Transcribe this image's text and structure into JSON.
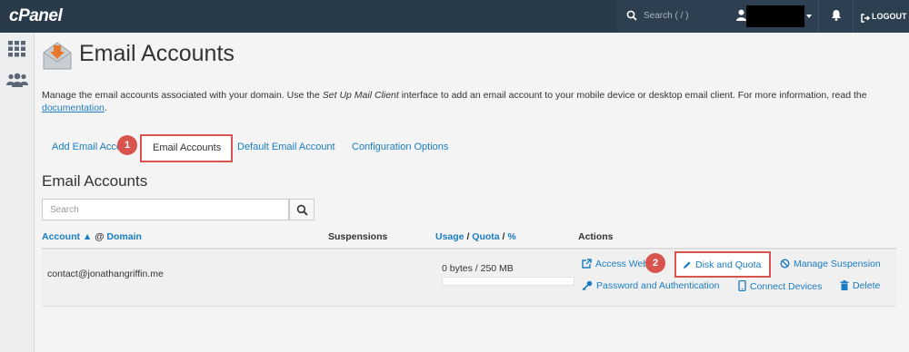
{
  "topbar": {
    "logo": "cPanel",
    "search_placeholder": "Search ( / )",
    "logout_label": "LOGOUT"
  },
  "page": {
    "title": "Email Accounts",
    "description_part1": "Manage the email accounts associated with your domain. Use the ",
    "description_em": "Set Up Mail Client",
    "description_part2": " interface to add an email account to your mobile device or desktop email client. For more information, read the ",
    "description_link": "documentation",
    "description_end": "."
  },
  "tabs": [
    {
      "label": "Add Email Acco"
    },
    {
      "label": "Email Accounts",
      "active": true
    },
    {
      "label": "Default Email Account"
    },
    {
      "label": "Configuration Options"
    }
  ],
  "badges": {
    "one": "1",
    "two": "2"
  },
  "section": {
    "title": "Email Accounts",
    "search_placeholder": "Search"
  },
  "table": {
    "headers": {
      "account": "Account",
      "sort_arrow": "▲",
      "at": "@",
      "domain": "Domain",
      "suspensions": "Suspensions",
      "usage": "Usage",
      "slash1": "/",
      "quota": "Quota",
      "slash2": "/",
      "percent": "%",
      "actions": "Actions"
    },
    "rows": [
      {
        "account": "contact@jonathangriffin.me",
        "usage": "0 bytes / 250 MB",
        "usage_fraction": 0
      }
    ],
    "actions": {
      "access_webmail": "Access Webr",
      "disk_quota": "Disk and Quota",
      "manage_suspension": "Manage Suspension",
      "password_auth": "Password and Authentication",
      "connect_devices": "Connect Devices",
      "delete": "Delete"
    }
  },
  "colors": {
    "topbar": "#293a4a",
    "link": "#1a7cc3",
    "highlight": "#d9534f",
    "email_icon_accent": "#e8762c"
  },
  "icons": [
    "grid-icon",
    "users-icon",
    "search-icon",
    "user-icon",
    "bell-icon",
    "logout-icon",
    "email-envelope-icon",
    "external-link-icon",
    "pencil-icon",
    "ban-icon",
    "key-icon",
    "mobile-icon",
    "trash-icon"
  ]
}
